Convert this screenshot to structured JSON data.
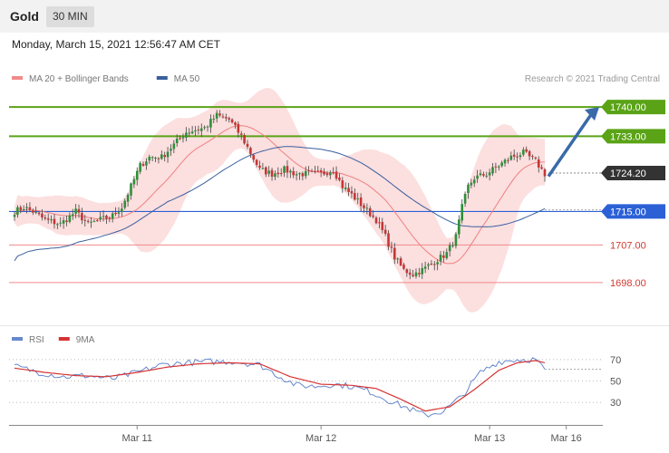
{
  "header": {
    "symbol": "Gold",
    "timeframe": "30 MIN"
  },
  "datetime": "Monday, March 15, 2021 12:56:47 AM CET",
  "colors": {
    "ma20": "#f08080",
    "ma50": "#3a5f9e",
    "bollinger_fill": "#fcd9d9",
    "resistance": "#5aa317",
    "pivot": "#2c61d6",
    "support": "#f08a8a",
    "current": "#333333",
    "bull_candle": "#2f8f3a",
    "bear_candle": "#c43636",
    "arrow": "#3a6aa8",
    "rsi": "#6688cc",
    "rsi_ma": "#d63333"
  },
  "chart_data": [
    {
      "type": "line",
      "title": "Gold 30 MIN",
      "legend": [
        {
          "name": "MA 20 + Bollinger Bands",
          "color": "#f08a8a"
        },
        {
          "name": "MA 50",
          "color": "#3a5f9e"
        }
      ],
      "legend_position": "top-left",
      "credit": "Research © 2021 Trading Central",
      "x_ticks": [
        "Mar 11",
        "Mar 12",
        "Mar 13",
        "Mar 16"
      ],
      "x_tick_index": [
        40,
        100,
        155,
        180
      ],
      "ylim": [
        1688,
        1745
      ],
      "levels": [
        {
          "label": "1740.00",
          "value": 1740.0,
          "kind": "resistance"
        },
        {
          "label": "1733.00",
          "value": 1733.0,
          "kind": "resistance"
        },
        {
          "label": "1724.20",
          "value": 1724.2,
          "kind": "current"
        },
        {
          "label": "1715.00",
          "value": 1715.0,
          "kind": "pivot"
        },
        {
          "label": "1707.00",
          "value": 1707.0,
          "kind": "support"
        },
        {
          "label": "1698.00",
          "value": 1698.0,
          "kind": "support"
        }
      ],
      "close_anchors": [
        [
          0,
          1715
        ],
        [
          3,
          1716
        ],
        [
          6,
          1715
        ],
        [
          10,
          1713
        ],
        [
          15,
          1712
        ],
        [
          20,
          1715
        ],
        [
          24,
          1712
        ],
        [
          28,
          1713
        ],
        [
          32,
          1714
        ],
        [
          35,
          1716
        ],
        [
          38,
          1721
        ],
        [
          41,
          1726
        ],
        [
          44,
          1728
        ],
        [
          48,
          1728
        ],
        [
          52,
          1731
        ],
        [
          56,
          1734
        ],
        [
          62,
          1735
        ],
        [
          66,
          1738
        ],
        [
          70,
          1737
        ],
        [
          74,
          1733
        ],
        [
          77,
          1729
        ],
        [
          80,
          1725
        ],
        [
          84,
          1724
        ],
        [
          88,
          1725
        ],
        [
          92,
          1724
        ],
        [
          96,
          1724
        ],
        [
          100,
          1724
        ],
        [
          104,
          1725
        ],
        [
          107,
          1721
        ],
        [
          110,
          1719
        ],
        [
          114,
          1716
        ],
        [
          118,
          1713
        ],
        [
          121,
          1709
        ],
        [
          124,
          1704
        ],
        [
          127,
          1701
        ],
        [
          130,
          1700
        ],
        [
          133,
          1701
        ],
        [
          137,
          1703
        ],
        [
          141,
          1705
        ],
        [
          144,
          1709
        ],
        [
          146,
          1716
        ],
        [
          148,
          1721
        ],
        [
          150,
          1723
        ],
        [
          154,
          1724
        ],
        [
          158,
          1726
        ],
        [
          162,
          1728
        ],
        [
          166,
          1729
        ],
        [
          170,
          1727
        ],
        [
          173,
          1724
        ]
      ],
      "forecast_target": 1740.0
    },
    {
      "type": "line",
      "legend": [
        {
          "name": "RSI",
          "color": "#6688cc"
        },
        {
          "name": "9MA",
          "color": "#d63333"
        }
      ],
      "ylim": [
        15,
        80
      ],
      "y_ticks": [
        70,
        50,
        30
      ],
      "rsi_anchors": [
        [
          0,
          64
        ],
        [
          8,
          58
        ],
        [
          16,
          54
        ],
        [
          24,
          55
        ],
        [
          32,
          52
        ],
        [
          40,
          58
        ],
        [
          48,
          65
        ],
        [
          56,
          67
        ],
        [
          64,
          68
        ],
        [
          72,
          68
        ],
        [
          80,
          65
        ],
        [
          86,
          55
        ],
        [
          92,
          46
        ],
        [
          98,
          45
        ],
        [
          104,
          47
        ],
        [
          110,
          45
        ],
        [
          116,
          40
        ],
        [
          122,
          32
        ],
        [
          128,
          25
        ],
        [
          134,
          18
        ],
        [
          140,
          22
        ],
        [
          146,
          36
        ],
        [
          152,
          58
        ],
        [
          158,
          68
        ],
        [
          164,
          70
        ],
        [
          170,
          70
        ],
        [
          173,
          60
        ]
      ],
      "ma_anchors": [
        [
          0,
          62
        ],
        [
          10,
          58
        ],
        [
          20,
          55
        ],
        [
          30,
          54
        ],
        [
          40,
          58
        ],
        [
          50,
          63
        ],
        [
          60,
          66
        ],
        [
          70,
          67
        ],
        [
          80,
          66
        ],
        [
          90,
          54
        ],
        [
          100,
          47
        ],
        [
          110,
          46
        ],
        [
          118,
          43
        ],
        [
          126,
          33
        ],
        [
          134,
          22
        ],
        [
          142,
          26
        ],
        [
          150,
          42
        ],
        [
          158,
          60
        ],
        [
          164,
          67
        ],
        [
          170,
          69
        ],
        [
          173,
          67
        ]
      ]
    }
  ]
}
